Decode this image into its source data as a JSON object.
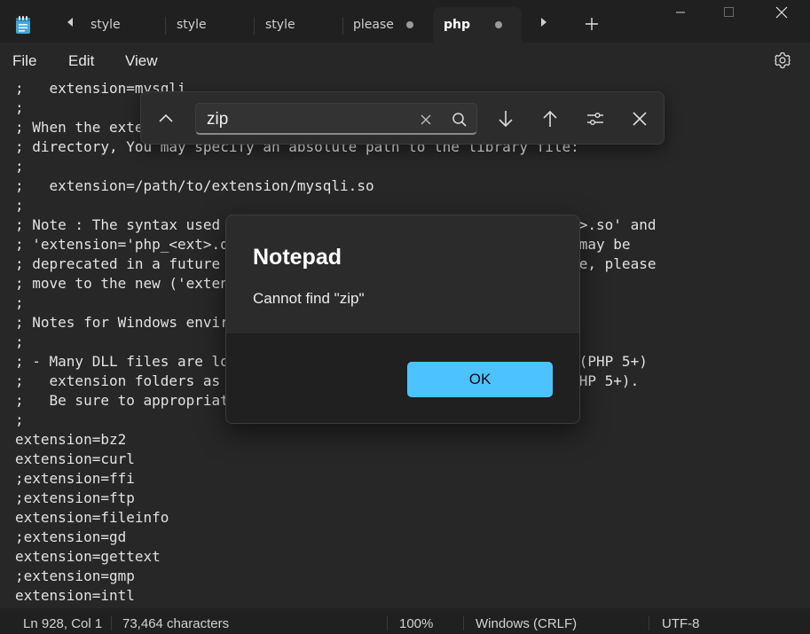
{
  "window": {
    "app_icon": "notepad-icon",
    "tab_scroll_left_icon": "caret-left-icon",
    "tab_scroll_right_icon": "caret-right-icon",
    "new_tab_icon": "plus-icon",
    "controls": [
      "minimize-icon",
      "maximize-icon",
      "close-icon"
    ]
  },
  "tabs": [
    {
      "label": "style",
      "active": false,
      "unsaved": false
    },
    {
      "label": "style",
      "active": false,
      "unsaved": false
    },
    {
      "label": "style",
      "active": false,
      "unsaved": false
    },
    {
      "label": "please",
      "active": false,
      "unsaved": true
    },
    {
      "label": "php",
      "active": true,
      "unsaved": true
    }
  ],
  "menu": {
    "items": [
      "File",
      "Edit",
      "View"
    ],
    "settings_icon": "gear-icon"
  },
  "editor": {
    "lines": [
      ";   extension=mysqli",
      ";",
      "; When the extension library to load is not located in the default extension",
      "; directory, You may specify an absolute path to the library file:",
      ";",
      ";   extension=/path/to/extension/mysqli.so",
      ";",
      "; Note : The syntax used in previous PHP versions ('extension=<ext>.so' and",
      "; 'extension='php_<ext>.dll') is supported for legacy reasons and may be",
      "; deprecated in a future PHP major version. So, when it is possible, please",
      "; move to the new ('extension=<ext>) syntax.",
      ";",
      "; Notes for Windows environments :",
      ";",
      "; - Many DLL files are located in the extensions/ (PHP 4) or ext/ (PHP 5+)",
      ";   extension folders as well as the separate PECL DLL download (PHP 5+).",
      ";   Be sure to appropriately set the extension_dir directive.",
      ";",
      "extension=bz2",
      "extension=curl",
      ";extension=ffi",
      ";extension=ftp",
      "extension=fileinfo",
      ";extension=gd",
      "extension=gettext",
      ";extension=gmp",
      "extension=intl"
    ]
  },
  "find": {
    "query": "zip",
    "icons": {
      "collapse": "chevron-up-icon",
      "clear": "clear-x-icon",
      "search": "search-icon",
      "next": "arrow-down-icon",
      "previous": "arrow-up-icon",
      "options": "sliders-icon",
      "close": "close-icon"
    }
  },
  "dialog": {
    "title": "Notepad",
    "message": "Cannot find \"zip\"",
    "ok_label": "OK",
    "accent": "#4cc2ff"
  },
  "status": {
    "position": "Ln 928, Col 1",
    "characters": "73,464 characters",
    "zoom": "100%",
    "line_ending": "Windows (CRLF)",
    "encoding": "UTF-8"
  }
}
